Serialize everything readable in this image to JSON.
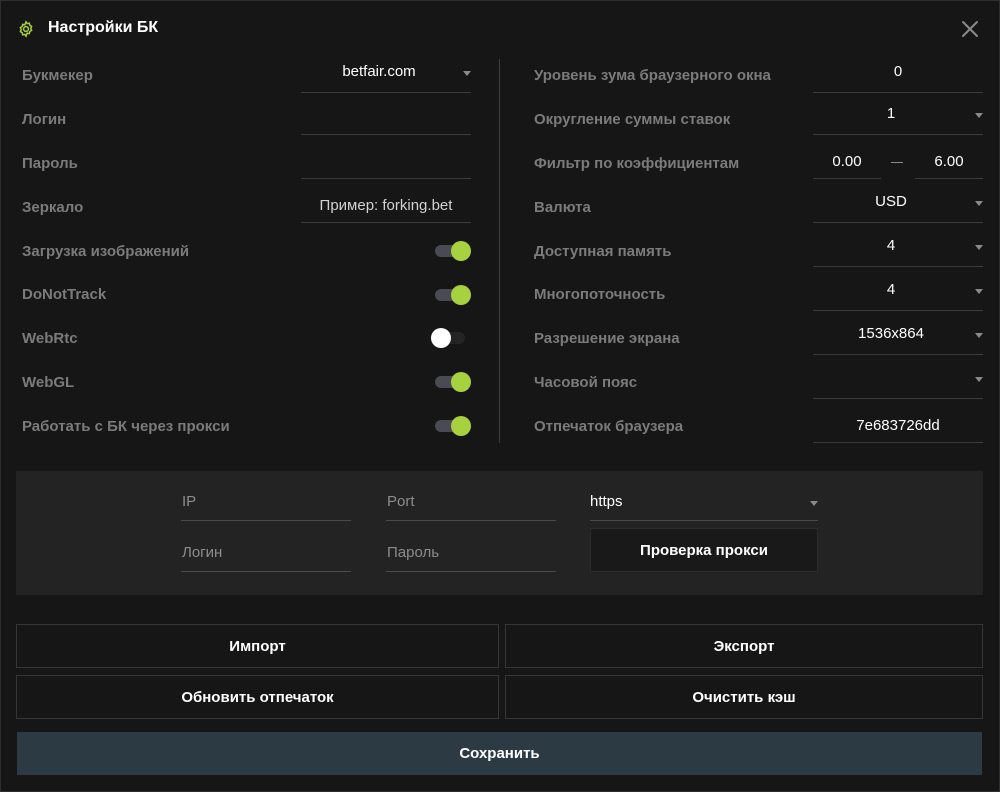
{
  "window": {
    "title": "Настройки БК",
    "accent_color": "#a8d140",
    "title_icon": "gear-icon",
    "close_icon": "close-icon"
  },
  "left": {
    "bookmaker": {
      "label": "Букмекер",
      "value": "betfair.com"
    },
    "login": {
      "label": "Логин",
      "value": ""
    },
    "password": {
      "label": "Пароль",
      "value": ""
    },
    "mirror": {
      "label": "Зеркало",
      "placeholder": "Пример: forking.bet"
    },
    "toggles": {
      "images": {
        "label": "Загрузка изображений",
        "on": true
      },
      "dnt": {
        "label": "DoNotTrack",
        "on": true
      },
      "webrtc": {
        "label": "WebRtc",
        "on": false
      },
      "webgl": {
        "label": "WebGL",
        "on": true
      },
      "proxy": {
        "label": "Работать с БК через прокси",
        "on": true
      }
    }
  },
  "right": {
    "zoom": {
      "label": "Уровень зума браузерного окна",
      "value": "0"
    },
    "rounding": {
      "label": "Округление суммы ставок",
      "value": "1"
    },
    "odds_filter": {
      "label": "Фильтр по коэффициентам",
      "min": "0.00",
      "max": "6.00"
    },
    "currency": {
      "label": "Валюта",
      "value": "USD"
    },
    "memory": {
      "label": "Доступная память",
      "value": "4"
    },
    "threads": {
      "label": "Многопоточность",
      "value": "4"
    },
    "resolution": {
      "label": "Разрешение экрана",
      "value": "1536x864"
    },
    "timezone": {
      "label": "Часовой пояс",
      "value": ""
    },
    "fingerprint": {
      "label": "Отпечаток браузера",
      "value": "7e683726dd"
    }
  },
  "proxy": {
    "ip_placeholder": "IP",
    "port_placeholder": "Port",
    "login_placeholder": "Логин",
    "password_placeholder": "Пароль",
    "protocol": "https",
    "check_label": "Проверка прокси"
  },
  "actions": {
    "import_label": "Импорт",
    "export_label": "Экспорт",
    "refresh_label": "Обновить отпечаток",
    "clear_label": "Очистить кэш",
    "save_label": "Сохранить"
  }
}
